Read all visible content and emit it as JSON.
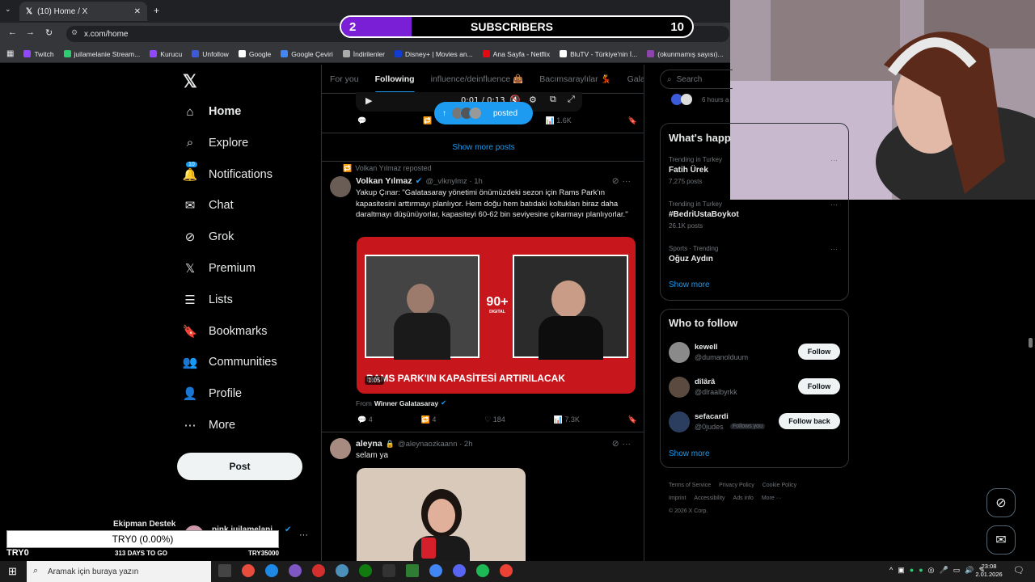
{
  "browser": {
    "tab_title": "(10) Home / X",
    "url": "x.com/home",
    "bookmarks": [
      {
        "label": "Twitch",
        "color": "#9146ff"
      },
      {
        "label": "juilamelanie Stream...",
        "color": "#2ecc71"
      },
      {
        "label": "Kurucu",
        "color": "#9146ff"
      },
      {
        "label": "Unfollow",
        "color": "#3b5bdb"
      },
      {
        "label": "Google",
        "color": "#ffffff"
      },
      {
        "label": "Google Çeviri",
        "color": "#4285f4"
      },
      {
        "label": "İndirilenler",
        "color": "#aaaaaa"
      },
      {
        "label": "Disney+ | Movies an...",
        "color": "#113ccf"
      },
      {
        "label": "Ana Sayfa - Netflix",
        "color": "#e50914"
      },
      {
        "label": "BluTV - Türkiye'nin İ...",
        "color": "#ffffff"
      },
      {
        "label": "(okunmamış sayısı)...",
        "color": "#8e44ad"
      },
      {
        "label": "ju",
        "color": "#cccccc"
      }
    ]
  },
  "subscribers": {
    "current": "2",
    "label": "SUBSCRIBERS",
    "goal": "10",
    "fraction": 0.2
  },
  "nav": {
    "items": [
      {
        "label": "Home",
        "icon": "home-icon"
      },
      {
        "label": "Explore",
        "icon": "search-icon"
      },
      {
        "label": "Notifications",
        "icon": "bell-icon",
        "badge": "10"
      },
      {
        "label": "Chat",
        "icon": "mail-icon"
      },
      {
        "label": "Grok",
        "icon": "grok-icon"
      },
      {
        "label": "Premium",
        "icon": "x-icon"
      },
      {
        "label": "Lists",
        "icon": "list-icon"
      },
      {
        "label": "Bookmarks",
        "icon": "bookmark-icon"
      },
      {
        "label": "Communities",
        "icon": "people-icon"
      },
      {
        "label": "Profile",
        "icon": "person-icon"
      },
      {
        "label": "More",
        "icon": "more-icon"
      }
    ],
    "post_label": "Post",
    "account_name": "pink juilamelani",
    "account_prefix": "Ekipman Destek"
  },
  "feed": {
    "tabs": [
      "For you",
      "Following",
      "influence/deinfluence 👜",
      "Bacımsaraylılar 💃",
      "Gala"
    ],
    "video_time": "0:01 / 0:13",
    "posted_pill": "posted",
    "top_views": "1.6K",
    "show_more_posts": "Show more posts",
    "post1": {
      "repost_line": "Volkan Yılmaz reposted",
      "name": "Volkan Yılmaz",
      "handle": "@_vlknylmz · 1h",
      "text": "Yakup Çınar: \"Galatasaray yönetimi önümüzdeki sezon için Rams Park'ın kapasitesini arttırmayı planlıyor. Hem doğu hem batıdaki koltukları biraz daha daraltmayı düşünüyorlar, kapasiteyi 60-62 bin seviyesine çıkarmayı planlıyorlar.\"",
      "media_caption": "RAMS PARK'IN KAPASİTESİ ARTIRILACAK",
      "media_logo": "90+",
      "media_logo_sub": "DIGITAL",
      "duration": "1:05",
      "from_prefix": "From",
      "from_name": "Winner Galatasaray",
      "replies": "4",
      "reposts": "4",
      "likes": "184",
      "views": "7.3K"
    },
    "post2": {
      "name": "aleyna",
      "handle": "@aleynaozkaann · 2h",
      "text": "selam ya"
    }
  },
  "right": {
    "search_placeholder": "Search",
    "top_time": "6 hours a",
    "trends_title": "What's happ",
    "trends": [
      {
        "meta": "Trending in Turkey",
        "title": "Fatih Ürek",
        "count": "7,275 posts"
      },
      {
        "meta": "Trending in Turkey",
        "title": "#BedriUstaBoykot",
        "count": "26.1K posts"
      },
      {
        "meta": "Sports · Trending",
        "title": "Oğuz Aydın",
        "count": ""
      }
    ],
    "show_more": "Show more",
    "who_title": "Who to follow",
    "who": [
      {
        "name": "kewell",
        "handle": "@dumanolduum",
        "button": "Follow",
        "follows_you": ""
      },
      {
        "name": "dîlârâ",
        "handle": "@dlraalbyrkk",
        "button": "Follow",
        "follows_you": ""
      },
      {
        "name": "sefacardi",
        "handle": "@0judes",
        "button": "Follow back",
        "follows_you": "Follows you"
      }
    ],
    "who_show_more": "Show more",
    "footer": [
      "Terms of Service",
      "Privacy Policy",
      "Cookie Policy",
      "Imprint",
      "Accessibility",
      "Ads info",
      "More ···",
      "© 2026 X Corp."
    ]
  },
  "overlay": {
    "value": "TRY0 (0.00%)",
    "left": "TRY0",
    "days": "313 DAYS TO GO",
    "goal": "TRY35000"
  },
  "taskbar": {
    "search_placeholder": "Aramak için buraya yazın",
    "time": "23:08",
    "date": "2.01.2026"
  }
}
